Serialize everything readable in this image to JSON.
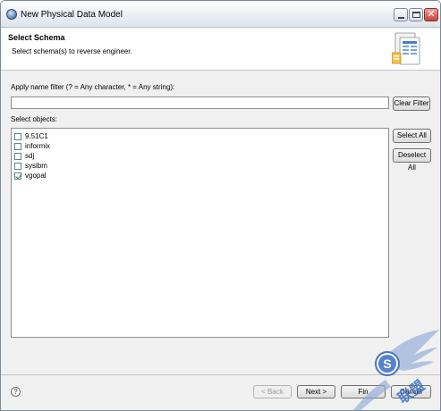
{
  "window": {
    "title": "New Physical Data Model"
  },
  "header": {
    "title": "Select Schema",
    "description": "Select schema(s) to reverse engineer."
  },
  "filter": {
    "label": "Apply name filter (? = Any character, * = Any string):",
    "value": "",
    "clear_label": "Clear Filter"
  },
  "objects": {
    "label": "Select objects:",
    "items": [
      {
        "label": "9.51C1",
        "checked": false
      },
      {
        "label": "informix",
        "checked": false
      },
      {
        "label": "sdj",
        "checked": false
      },
      {
        "label": "sysibm",
        "checked": false
      },
      {
        "label": "vgopal",
        "checked": true
      }
    ],
    "select_all_label": "Select All",
    "deselect_all_label": "Deselect All"
  },
  "footer": {
    "help_glyph": "?",
    "back_label": "< Back",
    "next_label": "Next >",
    "finish_label": "Fin",
    "cancel_label": "Cancel"
  },
  "watermark": {
    "text": "S 联盟"
  }
}
